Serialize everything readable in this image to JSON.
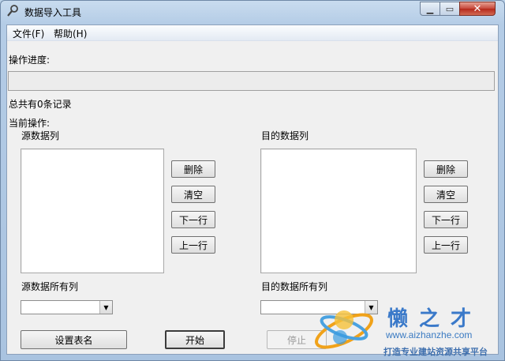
{
  "window": {
    "title": "数据导入工具"
  },
  "menu": {
    "file": "文件(F)",
    "help": "帮助(H)"
  },
  "progress": {
    "label": "操作进度:",
    "value": 0
  },
  "status": {
    "total_records": "总共有0条记录",
    "current_op_label": "当前操作:"
  },
  "source": {
    "list_label": "源数据列",
    "all_cols_label": "源数据所有列",
    "selected_value": ""
  },
  "target": {
    "list_label": "目的数据列",
    "all_cols_label": "目的数据所有列",
    "selected_value": ""
  },
  "buttons": {
    "delete": "删除",
    "clear": "清空",
    "down": "下一行",
    "up": "上一行",
    "set_table": "设置表名",
    "start": "开始",
    "stop": "停止"
  },
  "watermark": {
    "brand": "懒之才",
    "url": "www.aizhanzhe.com",
    "tagline": "打造专业建站资源共享平台"
  },
  "colors": {
    "window_frame": "#b4cce6",
    "client_bg": "#f0f0f0",
    "close_button": "#c6473a",
    "watermark": "#3a79c9"
  }
}
